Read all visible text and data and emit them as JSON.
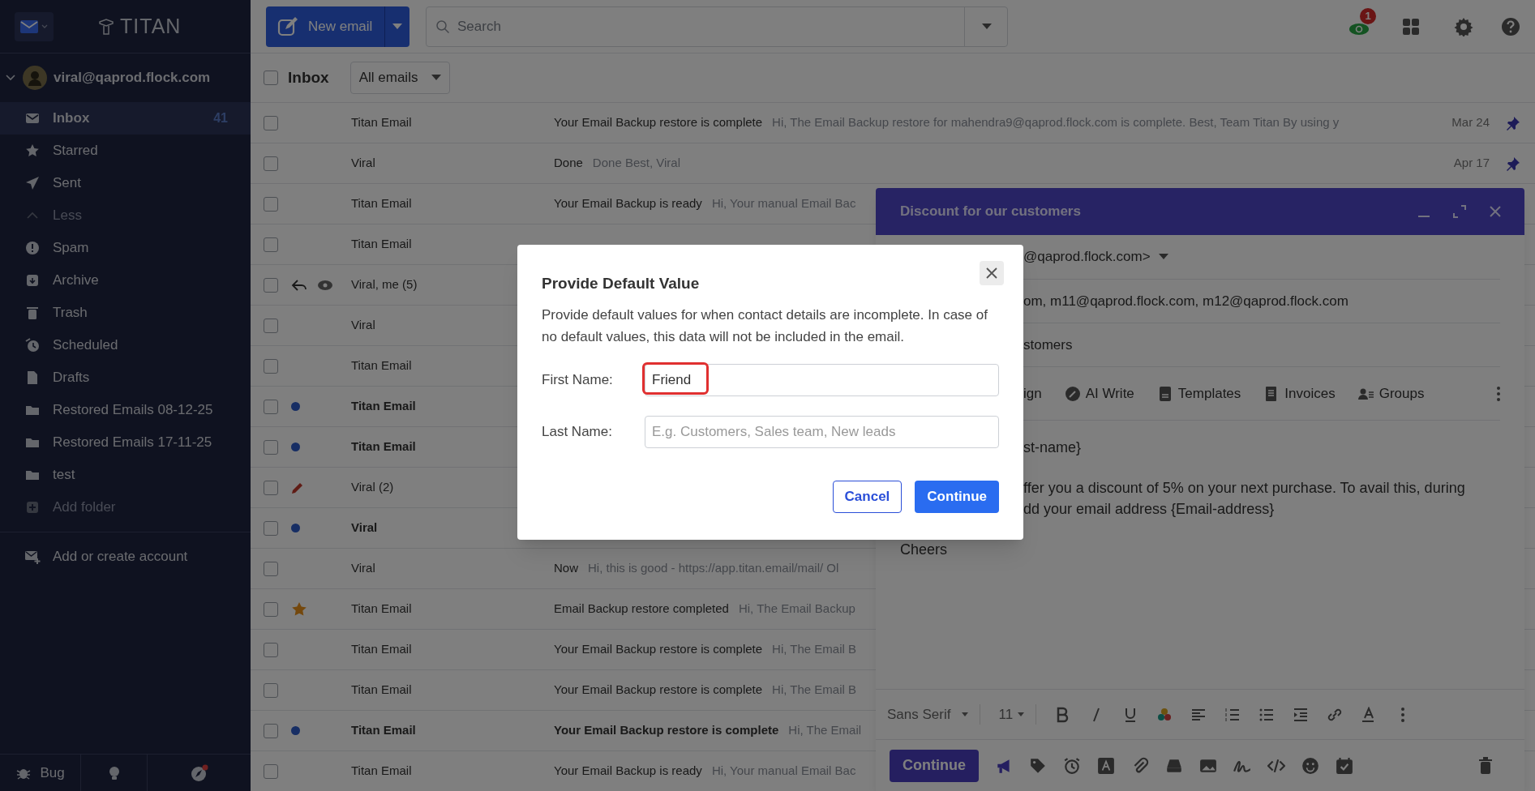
{
  "app": {
    "logo": "TITAN"
  },
  "account": {
    "email": "viral@qaprod.flock.com",
    "expanded": true
  },
  "sidebar": {
    "items": [
      {
        "kind": "inbox",
        "label": "Inbox",
        "count": "41",
        "selected": true,
        "dim": false
      },
      {
        "kind": "star",
        "label": "Starred",
        "selected": false,
        "dim": false
      },
      {
        "kind": "sent",
        "label": "Sent",
        "selected": false,
        "dim": false
      },
      {
        "kind": "less",
        "label": "Less",
        "selected": false,
        "dim": true
      },
      {
        "kind": "spam",
        "label": "Spam",
        "selected": false,
        "dim": false
      },
      {
        "kind": "archive",
        "label": "Archive",
        "selected": false,
        "dim": false
      },
      {
        "kind": "trash",
        "label": "Trash",
        "selected": false,
        "dim": false
      },
      {
        "kind": "scheduled",
        "label": "Scheduled",
        "selected": false,
        "dim": false
      },
      {
        "kind": "drafts",
        "label": "Drafts",
        "selected": false,
        "dim": false
      },
      {
        "kind": "folder",
        "label": "Restored Emails 08-12-25",
        "selected": false,
        "dim": false
      },
      {
        "kind": "folder",
        "label": "Restored Emails 17-11-25",
        "selected": false,
        "dim": false
      },
      {
        "kind": "folder",
        "label": "test",
        "selected": false,
        "dim": false
      },
      {
        "kind": "add",
        "label": "Add folder",
        "selected": false,
        "dim": true
      }
    ],
    "add_account": "Add or create account",
    "footer": {
      "bug": "Bug"
    }
  },
  "toolbar": {
    "new_email": "New email",
    "search_placeholder": "Search",
    "notification_badge": "1"
  },
  "list_header": {
    "title": "Inbox",
    "filter": "All emails",
    "checked": false
  },
  "emails": [
    {
      "sender": "Titan Email",
      "checked": false,
      "unread": false,
      "starred": false,
      "replied": false,
      "seen": false,
      "draft": false,
      "subject": "Your Email Backup restore is complete",
      "preview": "Hi, The Email Backup restore for mahendra9@qaprod.flock.com is complete. Best, Team Titan By using y",
      "date": "Mar 24",
      "pinned": true
    },
    {
      "sender": "Viral",
      "checked": false,
      "unread": false,
      "starred": false,
      "replied": false,
      "seen": false,
      "draft": false,
      "subject": "Done",
      "preview": "Done Best, Viral",
      "date": "Apr 17",
      "pinned": true
    },
    {
      "sender": "Titan Email",
      "checked": false,
      "unread": false,
      "starred": false,
      "replied": false,
      "seen": false,
      "draft": false,
      "subject": "Your Email Backup is ready",
      "preview": "Hi, Your manual Email Bac"
    },
    {
      "sender": "Titan Email",
      "checked": false,
      "unread": false,
      "starred": false,
      "replied": false,
      "seen": false,
      "draft": false
    },
    {
      "sender": "Viral, me (5)",
      "checked": false,
      "unread": false,
      "starred": false,
      "replied": true,
      "seen": true,
      "draft": false
    },
    {
      "sender": "Viral",
      "checked": false,
      "unread": false,
      "starred": false,
      "replied": false,
      "seen": false,
      "draft": false
    },
    {
      "sender": "Titan Email",
      "checked": false,
      "unread": false,
      "starred": false,
      "replied": false,
      "seen": false,
      "draft": false
    },
    {
      "sender": "Titan Email",
      "checked": false,
      "unread": true,
      "starred": false,
      "replied": false,
      "seen": false,
      "draft": false
    },
    {
      "sender": "Titan Email",
      "checked": false,
      "unread": true,
      "starred": false,
      "replied": false,
      "seen": false,
      "draft": false
    },
    {
      "sender": "Viral (2)",
      "checked": false,
      "unread": false,
      "starred": false,
      "replied": false,
      "seen": false,
      "draft": true
    },
    {
      "sender": "Viral",
      "checked": false,
      "unread": true,
      "starred": false,
      "replied": false,
      "seen": false,
      "draft": false
    },
    {
      "sender": "Viral",
      "checked": false,
      "unread": false,
      "starred": false,
      "replied": false,
      "seen": false,
      "draft": false,
      "subject": "Now",
      "preview": "Hi, this is good - https://app.titan.email/mail/ Ol"
    },
    {
      "sender": "Titan Email",
      "checked": false,
      "unread": false,
      "starred": true,
      "replied": false,
      "seen": false,
      "draft": false,
      "subject": "Email Backup restore completed",
      "preview": "Hi, The Email Backup"
    },
    {
      "sender": "Titan Email",
      "checked": false,
      "unread": false,
      "starred": false,
      "replied": false,
      "seen": false,
      "draft": false,
      "subject": "Your Email Backup restore is complete",
      "preview": "Hi, The Email B"
    },
    {
      "sender": "Titan Email",
      "checked": false,
      "unread": false,
      "starred": false,
      "replied": false,
      "seen": false,
      "draft": false,
      "subject": "Your Email Backup restore is complete",
      "preview": "Hi, The Email B"
    },
    {
      "sender": "Titan Email",
      "checked": false,
      "unread": true,
      "starred": false,
      "replied": false,
      "seen": false,
      "draft": false,
      "subject": "Your Email Backup restore is complete",
      "preview": "Hi, The Email"
    },
    {
      "sender": "Titan Email",
      "checked": false,
      "unread": false,
      "starred": false,
      "replied": false,
      "seen": false,
      "draft": false,
      "subject": "Your Email Backup is ready",
      "preview": "Hi, Your manual Email Bac"
    }
  ],
  "compose": {
    "title": "Discount for our customers",
    "from": "@qaprod.flock.com>",
    "to": "om, m11@qaprod.flock.com, m12@qaprod.flock.com",
    "subject": "stomers",
    "tools": [
      {
        "kind": "none",
        "label": "ign"
      },
      {
        "kind": "ai",
        "label": "AI Write"
      },
      {
        "kind": "template",
        "label": "Templates"
      },
      {
        "kind": "invoice",
        "label": "Invoices"
      },
      {
        "kind": "groups",
        "label": "Groups"
      }
    ],
    "body_fragments": [
      "st-name}",
      "ffer you a discount of 5% on your next purchase. To avail this, during",
      "dd your email address {Email-address}"
    ],
    "body_end": "Cheers",
    "font": "Sans Serif",
    "size": "11",
    "send": "Continue"
  },
  "dialog": {
    "title": "Provide Default Value",
    "description": "Provide default values for when contact details are incomplete. In case of no default values, this data will not be included in the email.",
    "fields": [
      {
        "label": "First Name:",
        "value": "Friend",
        "highlighted": true
      },
      {
        "label": "Last Name:",
        "placeholder": "E.g. Customers, Sales team, New leads",
        "highlighted": false
      }
    ],
    "cancel": "Cancel",
    "confirm": "Continue"
  }
}
